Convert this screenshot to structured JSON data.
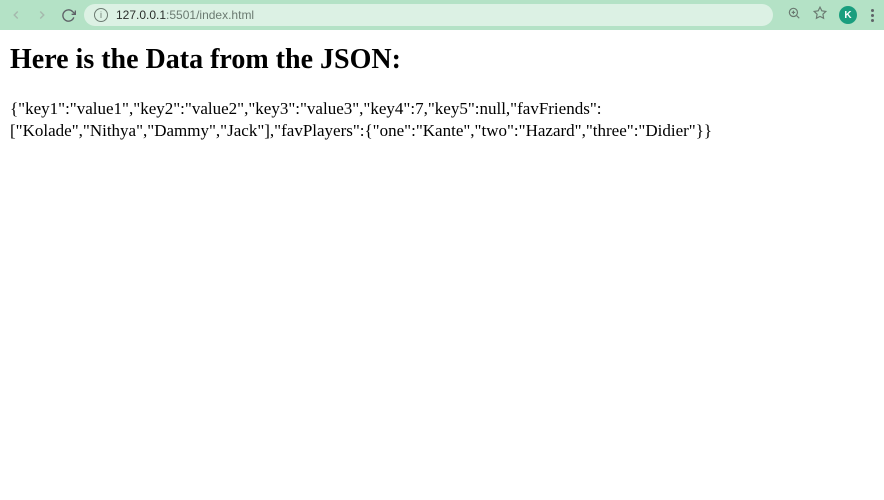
{
  "toolbar": {
    "url_host": "127.0.0.1",
    "url_port_path": ":5501/index.html",
    "profile_initial": "K"
  },
  "page": {
    "heading": "Here is the Data from the JSON:",
    "json_text": "{\"key1\":\"value1\",\"key2\":\"value2\",\"key3\":\"value3\",\"key4\":7,\"key5\":null,\"favFriends\":[\"Kolade\",\"Nithya\",\"Dammy\",\"Jack\"],\"favPlayers\":{\"one\":\"Kante\",\"two\":\"Hazard\",\"three\":\"Didier\"}}"
  }
}
